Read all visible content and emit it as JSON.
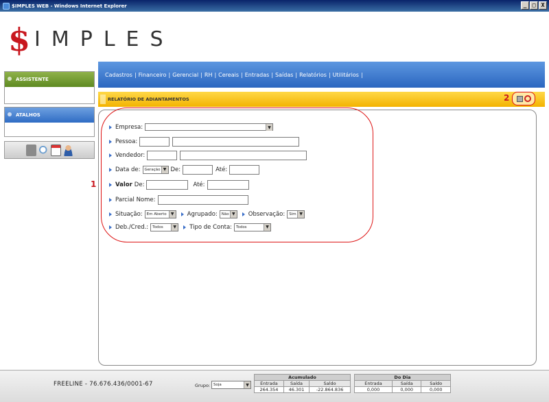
{
  "window": {
    "title": "$IMPLES WEB - Windows Internet Explorer",
    "minimize": "_",
    "restore": "□",
    "close": "X"
  },
  "logo": {
    "s": "$",
    "rest": "IMPLES"
  },
  "sidebar": {
    "assistente": "ASSISTENTE",
    "atalhos": "ATALHOS"
  },
  "menu": [
    "Cadastros",
    "Financeiro",
    "Gerencial",
    "RH",
    "Cereais",
    "Entradas",
    "Saídas",
    "Relatórios",
    "Utilitários"
  ],
  "menu_sep": "|",
  "report": {
    "title": "RELATÓRIO DE ADIANTAMENTOS"
  },
  "annotations": {
    "one": "1",
    "two": "2"
  },
  "form": {
    "empresa": "Empresa:",
    "pessoa": "Pessoa:",
    "vendedor": "Vendedor:",
    "data_de": "Data de:",
    "data_sel": "Geração",
    "de": "De:",
    "ate": "Até:",
    "valor": "Valor",
    "valor_de": "De:",
    "valor_ate": "Até:",
    "parcial_nome": "Parcial Nome:",
    "situacao": "Situação:",
    "situacao_sel": "Em Aberto",
    "agrupado": "Agrupado:",
    "agrupado_sel": "Não",
    "observacao": "Observação:",
    "observacao_sel": "Sim",
    "deb_cred": "Deb./Cred.:",
    "deb_cred_sel": "Todos",
    "tipo_conta": "Tipo de Conta:",
    "tipo_conta_sel": "Todos"
  },
  "footer": {
    "freeline": "FREELINE - 76.676.436/0001-67",
    "grupo_label": "Grupo:",
    "grupo_sel": "Soja",
    "acumulado": {
      "title": "Acumulado",
      "cols": [
        "Entrada",
        "Saída",
        "Saldo"
      ],
      "values": [
        "264.354",
        "46.301",
        "-22.864.836"
      ]
    },
    "do_dia": {
      "title": "Do Dia",
      "cols": [
        "Entrada",
        "Saída",
        "Saldo"
      ],
      "values": [
        "0,000",
        "0,000",
        "0,000"
      ]
    }
  }
}
